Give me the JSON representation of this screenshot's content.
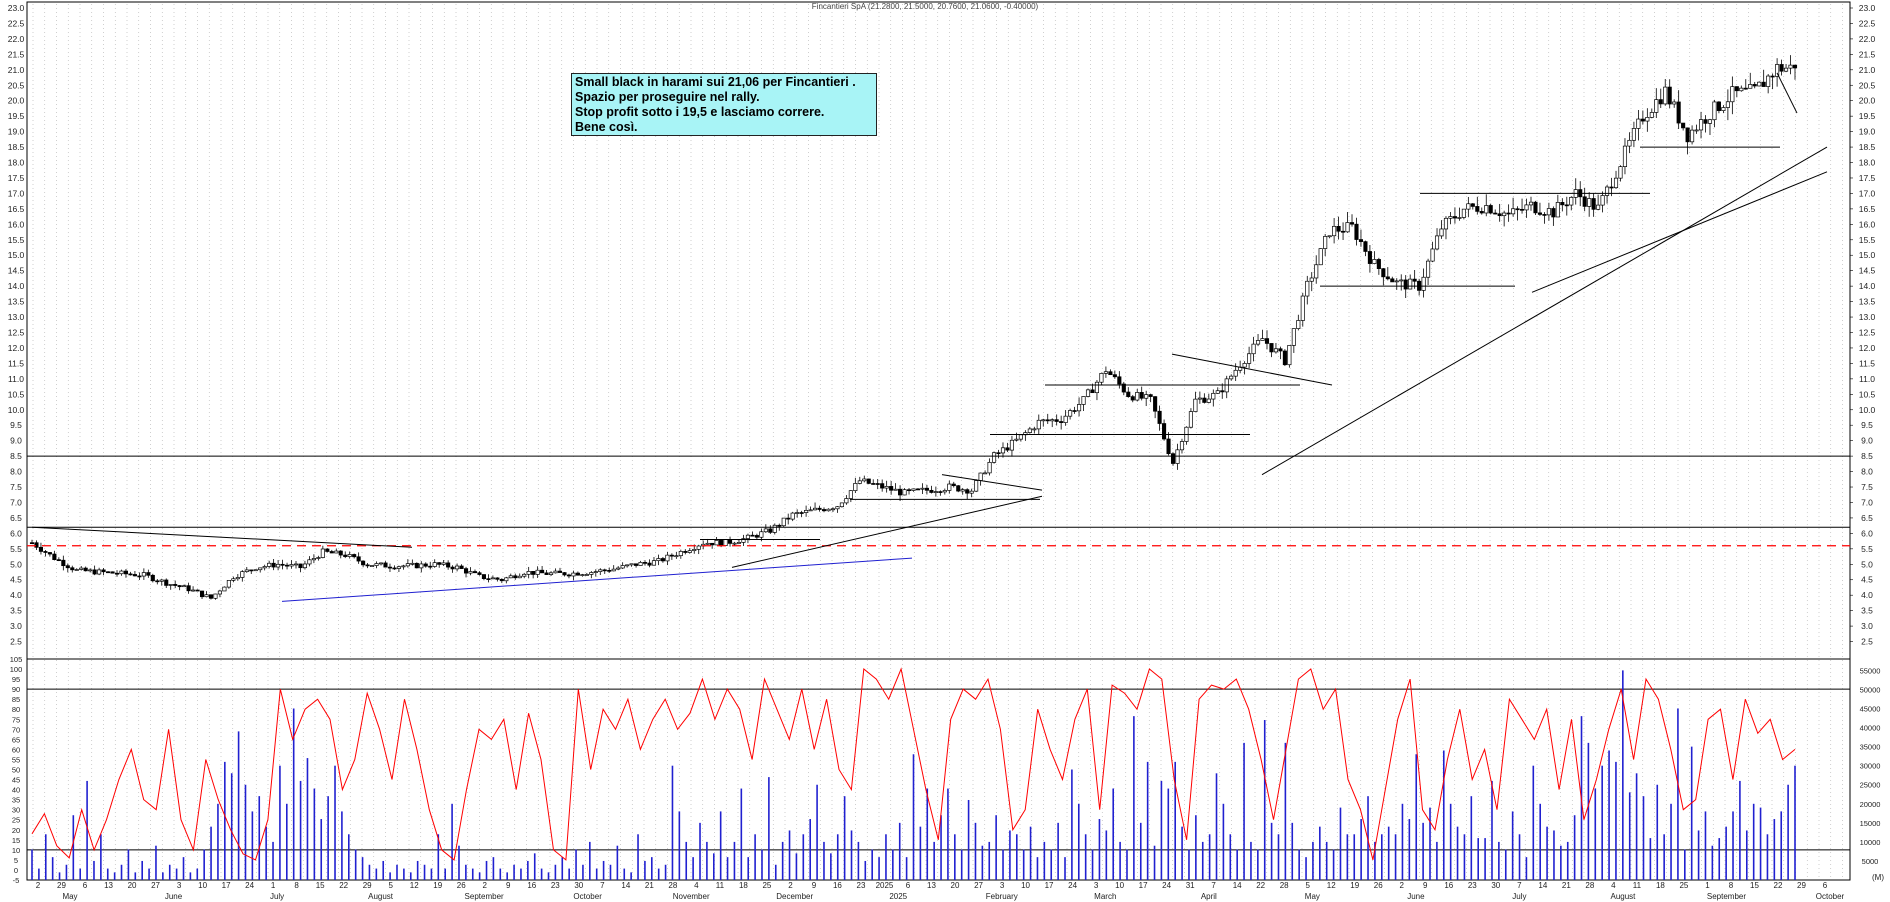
{
  "header": {
    "title": "Fincantieri SpA (21.2800, 21.5000, 20.7600, 21.0600, -0.40000)"
  },
  "note": {
    "lines": [
      "Small black in harami sui 21,06 per Fincantieri .",
      "Spazio per proseguire nel rally.",
      "Stop profit sotto i 19,5 e lasciamo correre.",
      "Bene così."
    ]
  },
  "colors": {
    "price_line": "#000000",
    "rsi_line": "#ff0000",
    "volume_bar": "#2020d0",
    "support_blue": "#2020d0",
    "dashed_red": "#ff0000",
    "note_bg": "#a8f4f6"
  },
  "chart_data": [
    {
      "type": "candlestick",
      "title": "Fincantieri SpA",
      "ylim": [
        2.0,
        23.0
      ],
      "ytick_labels": [
        "2.5",
        "3.0",
        "3.5",
        "4.0",
        "4.5",
        "5.0",
        "5.5",
        "6.0",
        "6.5",
        "7.0",
        "7.5",
        "8.0",
        "8.5",
        "9.0",
        "9.5",
        "10.0",
        "10.5",
        "11.0",
        "11.5",
        "12.0",
        "12.5",
        "13.0",
        "13.5",
        "14.0",
        "14.5",
        "15.0",
        "15.5",
        "16.0",
        "16.5",
        "17.0",
        "17.5",
        "18.0",
        "18.5",
        "19.0",
        "19.5",
        "20.0",
        "20.5",
        "21.0",
        "21.5",
        "22.0",
        "22.5",
        "23.0"
      ],
      "x_day_labels": [
        "2",
        "29",
        "6",
        "13",
        "20",
        "27",
        "3",
        "10",
        "17",
        "24",
        "1",
        "8",
        "15",
        "22",
        "29",
        "5",
        "12",
        "19",
        "26",
        "2",
        "9",
        "16",
        "23",
        "30",
        "7",
        "14",
        "21",
        "28",
        "4",
        "11",
        "18",
        "25",
        "2",
        "9",
        "16",
        "23",
        "2025",
        "6",
        "13",
        "20",
        "27",
        "3",
        "10",
        "17",
        "24",
        "3",
        "10",
        "17",
        "24",
        "31",
        "7",
        "14",
        "22",
        "28",
        "5",
        "12",
        "19",
        "26",
        "2",
        "9",
        "16",
        "23",
        "30",
        "7",
        "14",
        "21",
        "28",
        "4",
        "11",
        "18",
        "25",
        "1",
        "8",
        "15",
        "22",
        "29",
        "6"
      ],
      "x_month_labels": [
        "May",
        "June",
        "July",
        "August",
        "September",
        "October",
        "November",
        "December",
        "2025",
        "February",
        "March",
        "April",
        "May",
        "June",
        "July",
        "August",
        "September",
        "October"
      ],
      "horizontal_levels": [
        8.5,
        6.2,
        5.6
      ],
      "last_close": 21.06,
      "closes_weekly": [
        5.7,
        5.2,
        4.8,
        4.75,
        4.7,
        4.65,
        4.4,
        4.2,
        3.9,
        4.6,
        4.9,
        5.0,
        4.9,
        5.4,
        5.3,
        5.0,
        4.95,
        4.95,
        5.0,
        4.9,
        4.6,
        4.5,
        4.75,
        4.7,
        4.7,
        4.75,
        4.85,
        5.0,
        5.1,
        5.4,
        5.7,
        5.7,
        5.85,
        6.1,
        6.6,
        6.75,
        6.9,
        7.7,
        7.5,
        7.3,
        7.4,
        7.5,
        7.4,
        8.5,
        9.0,
        9.6,
        9.7,
        10.3,
        11.3,
        10.5,
        10.3,
        8.3,
        10.3,
        10.5,
        11.5,
        12.3,
        11.6,
        14.0,
        15.8,
        15.9,
        14.7,
        14.1,
        14.0,
        15.9,
        16.5,
        16.6,
        16.3,
        16.6,
        16.4,
        17.0,
        16.5,
        18.0,
        19.5,
        20.3,
        18.9,
        19.6,
        20.2,
        20.3,
        21.06
      ]
    },
    {
      "type": "line+bar",
      "series": [
        {
          "name": "",
          "kind": "oscillator",
          "ylim": [
            -5,
            105
          ],
          "values": [
            18,
            28,
            12,
            6,
            30,
            10,
            25,
            45,
            60,
            35,
            30,
            70,
            25,
            10,
            55,
            35,
            20,
            8,
            5,
            25,
            90,
            65,
            80,
            85,
            75,
            40,
            55,
            88,
            70,
            45,
            85,
            60,
            30,
            10,
            5,
            40,
            70,
            65,
            75,
            40,
            78,
            55,
            10,
            5,
            90,
            50,
            80,
            70,
            85,
            60,
            75,
            85,
            70,
            78,
            95,
            75,
            90,
            80,
            55,
            95,
            80,
            65,
            90,
            60,
            85,
            50,
            40,
            100,
            95,
            85,
            100,
            70,
            40,
            15,
            75,
            90,
            85,
            95,
            70,
            20,
            30,
            80,
            60,
            45,
            75,
            90,
            30,
            92,
            88,
            80,
            100,
            95,
            45,
            15,
            85,
            92,
            90,
            95,
            80,
            55,
            25,
            60,
            95,
            100,
            80,
            90,
            45,
            30,
            5,
            40,
            75,
            95,
            30,
            20,
            55,
            80,
            45,
            60,
            30,
            85,
            75,
            65,
            80,
            40,
            75,
            25,
            45,
            70,
            90,
            55,
            95,
            85,
            60,
            30,
            35,
            75,
            80,
            45,
            85,
            68,
            75,
            55,
            60
          ]
        },
        {
          "name": "",
          "kind": "volume",
          "ylim": [
            0,
            58000
          ],
          "ytick_labels": [
            "5000",
            "10000",
            "15000",
            "20000",
            "25000",
            "30000",
            "35000",
            "40000",
            "45000",
            "50000",
            "55000"
          ],
          "values": [
            8000,
            3000,
            12000,
            6000,
            2000,
            4000,
            17000,
            3000,
            26000,
            5000,
            12000,
            3000,
            2000,
            4000,
            8000,
            2000,
            5000,
            3000,
            9000,
            2000,
            4000,
            3000,
            6000,
            2000,
            3000,
            8000,
            14000,
            20000,
            31000,
            28000,
            39000,
            25000,
            18000,
            22000,
            14000,
            10000,
            30000,
            20000,
            45000,
            26000,
            32000,
            24000,
            16000,
            22000,
            30000,
            18000,
            12000,
            8000,
            6000,
            4000,
            3000,
            5000,
            2000,
            4000,
            3000,
            2000,
            5000,
            4000,
            3000,
            12000,
            3000,
            20000,
            9000,
            4000,
            3000,
            2000,
            5000,
            6000,
            3000,
            2000,
            4000,
            3000,
            5000,
            7000,
            3000,
            2000,
            4000,
            6000,
            3000,
            8000,
            4000,
            10000,
            3000,
            5000,
            4000,
            9000,
            3000,
            2000,
            12000,
            5000,
            6000,
            3000,
            4000,
            30000,
            18000,
            10000,
            6000,
            15000,
            10000,
            7000,
            18000,
            6000,
            10000,
            24000,
            6000,
            12000,
            8000,
            27000,
            4000,
            10000,
            13000,
            7000,
            12000,
            16000,
            25000,
            10000,
            7000,
            12000,
            22000,
            13000,
            10000,
            5000,
            8000,
            6000,
            12000,
            8000,
            15000,
            6000,
            33000,
            14000,
            24000,
            10000,
            17000,
            24000,
            12000,
            8000,
            21000,
            15000,
            9000,
            10000,
            17000,
            8000,
            13000,
            12000,
            8000,
            14000,
            6000,
            10000,
            8000,
            15000,
            6000,
            29000,
            20000,
            12000,
            8000,
            16000,
            13000,
            24000,
            10000,
            8000,
            43000,
            15000,
            31000,
            9000,
            26000,
            24000,
            31000,
            14000,
            8000,
            17000,
            10000,
            12000,
            28000,
            20000,
            12000,
            8000,
            36000,
            10000,
            8000,
            42000,
            15000,
            12000,
            36000,
            15000,
            8000,
            6000,
            10000,
            14000,
            10000,
            8000,
            19000,
            12000,
            12000,
            16000,
            22000,
            10000,
            12000,
            14000,
            12000,
            20000,
            16000,
            33000,
            15000,
            19000,
            10000,
            34000,
            20000,
            14000,
            12000,
            22000,
            11000,
            11000,
            26000,
            10000,
            8000,
            18000,
            12000,
            6000,
            30000,
            20000,
            14000,
            13000,
            9000,
            10000,
            17000,
            43000,
            36000,
            24000,
            30000,
            34000,
            31000,
            55000,
            23000,
            28000,
            22000,
            11000,
            25000,
            12000,
            20000,
            45000,
            8000,
            35000,
            13000,
            18000,
            9000,
            11000,
            14000,
            18000,
            26000,
            13000,
            20000,
            19000,
            12000,
            16000,
            18000,
            25000,
            30000
          ]
        }
      ],
      "horizontal_levels": [
        90,
        10
      ]
    }
  ],
  "xaxis_end_label": "(M)"
}
